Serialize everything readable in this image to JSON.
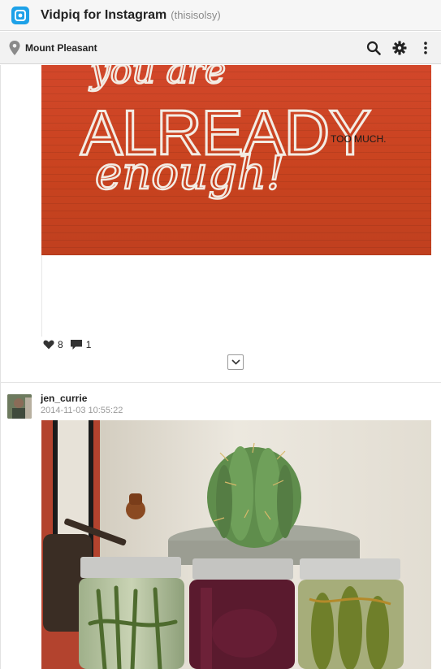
{
  "app": {
    "title": "Vidpiq for Instagram",
    "user": "(thisisolsy)",
    "accent": "#1da1e8"
  },
  "location": {
    "name": "Mount Pleasant",
    "icon": "map-pin-icon"
  },
  "toolbar": {
    "icons": [
      "search-icon",
      "gear-icon",
      "more-vertical-icon"
    ]
  },
  "posts": [
    {
      "image_text": [
        "you are",
        "ALREADY",
        "enough!",
        "TOO MUCH."
      ],
      "likes": "8",
      "comments": "1"
    },
    {
      "username": "jen_currie",
      "timestamp": "2014-11-03 10:55:22"
    }
  ]
}
